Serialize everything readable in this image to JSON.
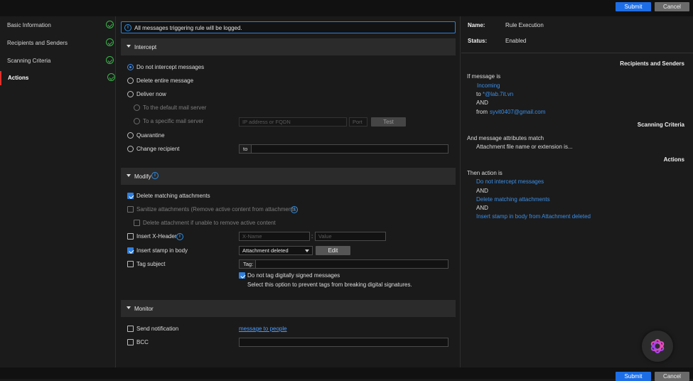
{
  "header": {
    "submit_label": "Submit",
    "cancel_label": "Cancel"
  },
  "footer": {
    "submit_label": "Submit",
    "cancel_label": "Cancel"
  },
  "nav": {
    "items": [
      {
        "label": "Basic Information",
        "complete": true
      },
      {
        "label": "Recipients and Senders",
        "complete": true
      },
      {
        "label": "Scanning Criteria",
        "complete": true
      },
      {
        "label": "Actions",
        "complete": true,
        "active": true
      }
    ]
  },
  "info_banner": "All messages triggering rule will be logged.",
  "intercept": {
    "title": "Intercept",
    "options": {
      "do_not_intercept": "Do not intercept messages",
      "delete_entire": "Delete entire message",
      "deliver_now": "Deliver now",
      "default_server": "To the default mail server",
      "specific_server": "To a specific mail server",
      "quarantine": "Quarantine",
      "change_recipient": "Change recipient"
    },
    "selected": "do_not_intercept",
    "ip_placeholder": "IP address or FQDN",
    "port_placeholder": "Port",
    "test_label": "Test",
    "to_label": "to"
  },
  "modify": {
    "title": "Modify",
    "delete_matching": {
      "label": "Delete matching attachments",
      "checked": true
    },
    "sanitize": {
      "label": "Sanitize attachments (Remove active content from attachments)",
      "checked": false
    },
    "delete_if_unable": {
      "label": "Delete attachment if unable to remove active content",
      "checked": false
    },
    "insert_xheader": {
      "label": "Insert X-Header",
      "checked": false,
      "name_placeholder": "X-Name",
      "value_placeholder": "Value"
    },
    "insert_stamp": {
      "label": "Insert stamp in body",
      "checked": true,
      "selected": "Attachment deleted",
      "edit_label": "Edit"
    },
    "tag_subject": {
      "label": "Tag subject",
      "checked": false,
      "tag_label": "Tag:"
    },
    "no_tag_signed": {
      "label": "Do not tag digitally signed messages",
      "checked": true,
      "hint": "Select this option to prevent tags from breaking digital signatures."
    }
  },
  "monitor": {
    "title": "Monitor",
    "send_notification": {
      "label": "Send notification",
      "checked": false,
      "link": "message to people"
    },
    "bcc": {
      "label": "BCC",
      "checked": false
    }
  },
  "summary": {
    "name_key": "Name:",
    "name_value": "Rule Execution",
    "status_key": "Status:",
    "status_value": "Enabled",
    "recipients_heading": "Recipients and Senders",
    "if_message_is": "If message is",
    "incoming": "Incoming",
    "to_word": "to",
    "to_value": "*@lab.7it.vn",
    "and1": "AND",
    "from_word": "from",
    "from_value": "syvit0407@gmail.com",
    "scanning_heading": "Scanning Criteria",
    "attributes_match": "And message attributes match",
    "attachment_criteria": "Attachment file name or extension is...",
    "actions_heading": "Actions",
    "then_action": "Then action is",
    "action1": "Do not intercept messages",
    "and2": "AND",
    "action2": "Delete matching attachments",
    "and3": "AND",
    "action3": "Insert stamp in body from Attachment deleted"
  },
  "colors": {
    "accent": "#1d6ee6",
    "success": "#3bb54a",
    "link": "#3b8fe8",
    "active_marker": "#e0302a"
  }
}
